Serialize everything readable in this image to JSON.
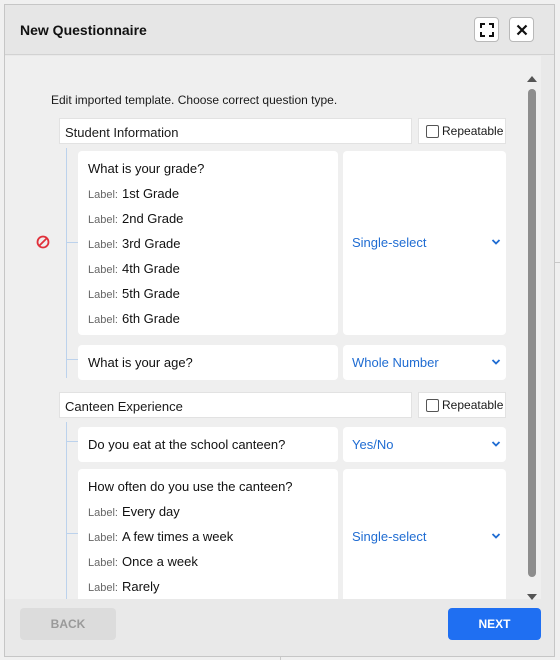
{
  "dialog": {
    "title": "New Questionnaire",
    "expand_icon": "expand-icon",
    "close_icon": "close-icon"
  },
  "instruction": "Edit imported template. Choose correct question type.",
  "sections": [
    {
      "title": "Student Information",
      "repeatable_label": "Repeatable",
      "repeatable_checked": false,
      "questions": [
        {
          "text": "What is your grade?",
          "type": "Single-select",
          "warning": true,
          "options": [
            {
              "label": "Label:",
              "value": "1st Grade"
            },
            {
              "label": "Label:",
              "value": "2nd Grade"
            },
            {
              "label": "Label:",
              "value": "3rd Grade"
            },
            {
              "label": "Label:",
              "value": "4th Grade"
            },
            {
              "label": "Label:",
              "value": "5th Grade"
            },
            {
              "label": "Label:",
              "value": "6th Grade"
            }
          ]
        },
        {
          "text": "What is your age?",
          "type": "Whole Number",
          "options": []
        }
      ]
    },
    {
      "title": "Canteen Experience",
      "repeatable_label": "Repeatable",
      "repeatable_checked": false,
      "questions": [
        {
          "text": "Do you eat at the school canteen?",
          "type": "Yes/No",
          "options": []
        },
        {
          "text": "How often do you use the canteen?",
          "type": "Single-select",
          "options": [
            {
              "label": "Label:",
              "value": "Every day"
            },
            {
              "label": "Label:",
              "value": "A few times a week"
            },
            {
              "label": "Label:",
              "value": "Once a week"
            },
            {
              "label": "Label:",
              "value": "Rarely"
            }
          ]
        }
      ]
    }
  ],
  "footer": {
    "back_label": "BACK",
    "next_label": "NEXT"
  },
  "colors": {
    "accent": "#1f6ff2",
    "type_text": "#1f6cd2",
    "warning": "#e0303a"
  }
}
